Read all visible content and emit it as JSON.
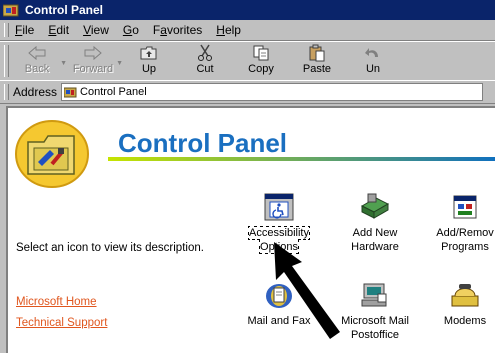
{
  "window": {
    "title": "Control Panel"
  },
  "menu": [
    "File",
    "Edit",
    "View",
    "Go",
    "Favorites",
    "Help"
  ],
  "menu_access": [
    "F",
    "E",
    "V",
    "G",
    "a",
    "H"
  ],
  "toolbar": {
    "back": "Back",
    "forward": "Forward",
    "up": "Up",
    "cut": "Cut",
    "copy": "Copy",
    "paste": "Paste",
    "undo": "Un"
  },
  "address": {
    "label": "Address",
    "value": "Control Panel"
  },
  "content": {
    "title": "Control Panel",
    "description": "Select an icon to view its description.",
    "links": [
      "Microsoft Home",
      "Technical Support"
    ]
  },
  "icons": [
    {
      "label": "Accessibility Options",
      "icon": "accessibility-icon"
    },
    {
      "label": "Add New Hardware",
      "icon": "hardware-icon"
    },
    {
      "label": "Add/Remov Programs",
      "icon": "programs-icon"
    },
    {
      "label": "Mail and Fax",
      "icon": "mail-fax-icon"
    },
    {
      "label": "Microsoft Mail Postoffice",
      "icon": "postoffice-icon"
    },
    {
      "label": "Modems",
      "icon": "modem-icon"
    }
  ],
  "colors": {
    "title_bar": "#0a246a",
    "heading": "#1a6fc0",
    "link": "#e0561e"
  }
}
